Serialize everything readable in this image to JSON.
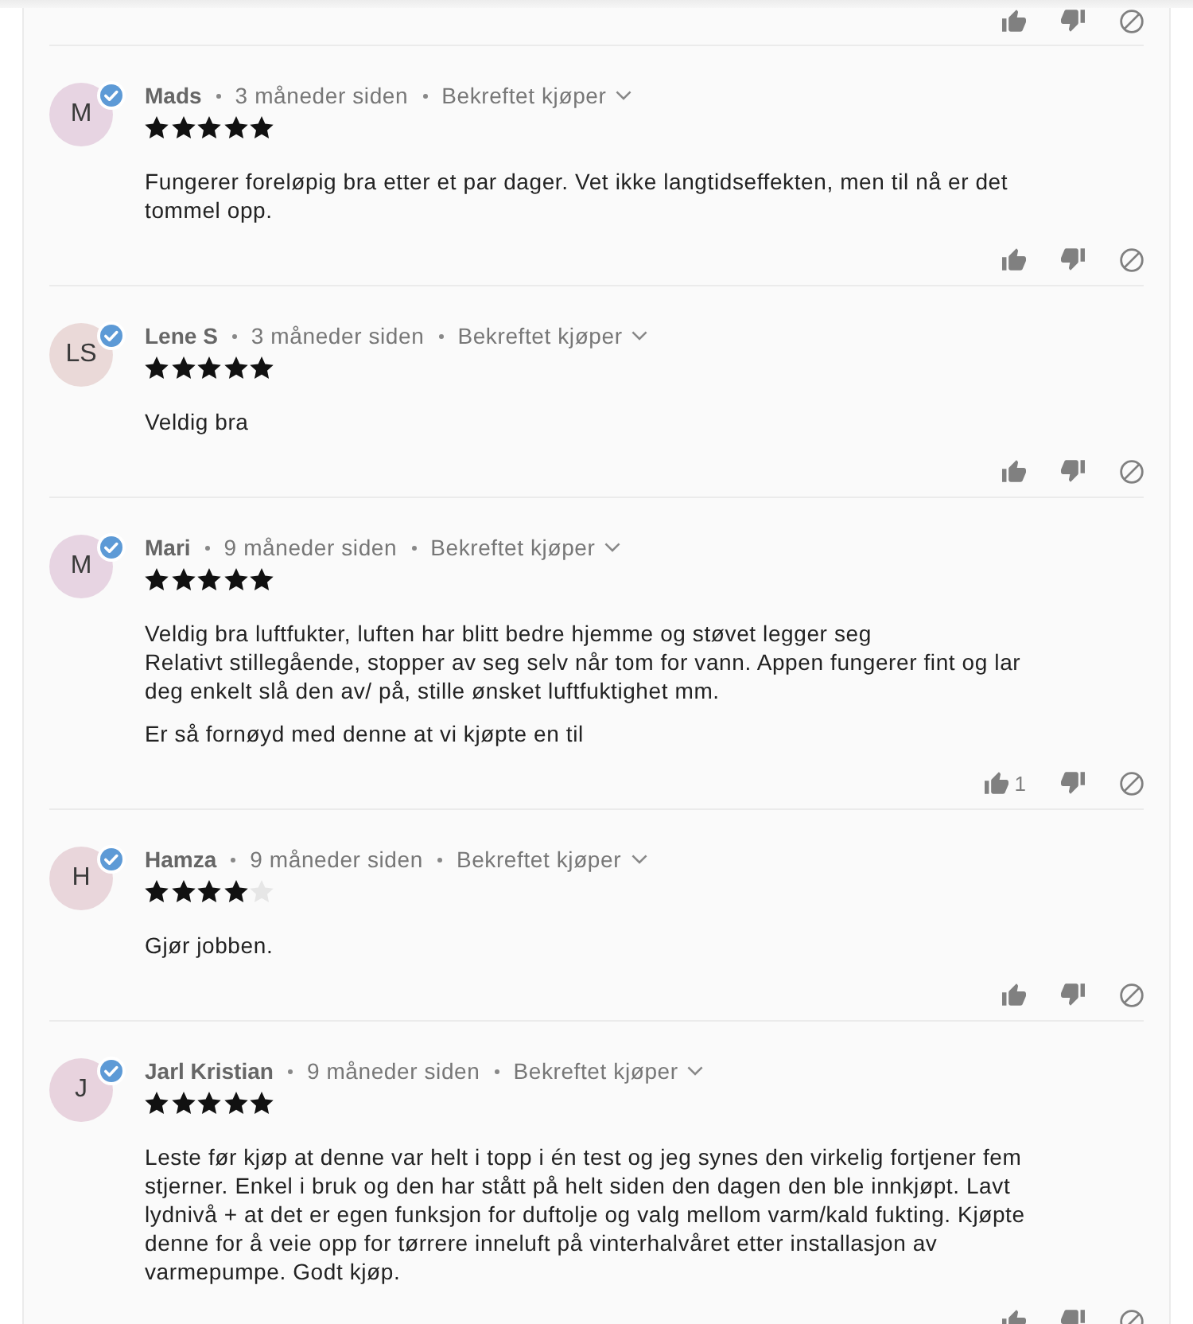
{
  "reviews": [
    {
      "avatar": {
        "initials": "M",
        "color": "#e7d4e2",
        "verified": true
      },
      "name": "Mads",
      "time": "3 måneder siden",
      "badge": "Bekreftet kjøper",
      "stars": 5,
      "paragraphs": [
        "Fungerer foreløpig bra etter et par dager. Vet ikke langtidseffekten, men til nå er det tommel opp."
      ]
    },
    {
      "avatar": {
        "initials": "LS",
        "color": "#ead9d8",
        "verified": true
      },
      "name": "Lene S",
      "time": "3 måneder siden",
      "badge": "Bekreftet kjøper",
      "stars": 5,
      "paragraphs": [
        "Veldig bra"
      ]
    },
    {
      "avatar": {
        "initials": "M",
        "color": "#e7d4e2",
        "verified": true
      },
      "name": "Mari",
      "time": "9 måneder siden",
      "badge": "Bekreftet kjøper",
      "stars": 5,
      "paragraphs": [
        "Veldig bra luftfukter, luften har blitt bedre hjemme og støvet legger seg\nRelativt stillegående, stopper av seg selv når tom for vann. Appen fungerer fint og lar deg enkelt slå den av/ på, stille ønsket luftfuktighet mm.",
        "Er så fornøyd med denne at vi kjøpte en til"
      ],
      "helpful_count": "1"
    },
    {
      "avatar": {
        "initials": "H",
        "color": "#e9d6db",
        "verified": true
      },
      "name": "Hamza",
      "time": "9 måneder siden",
      "badge": "Bekreftet kjøper",
      "stars": 4,
      "paragraphs": [
        "Gjør jobben."
      ]
    },
    {
      "avatar": {
        "initials": "J",
        "color": "#e8d3de",
        "verified": true
      },
      "name": "Jarl Kristian",
      "time": "9 måneder siden",
      "badge": "Bekreftet kjøper",
      "stars": 5,
      "paragraphs": [
        "Leste før kjøp at denne var helt i topp i én test og jeg synes den virkelig fortjener fem stjerner. Enkel i bruk og den har stått på helt siden den dagen den ble innkjøpt. Lavt lydnivå + at det er egen funksjon for duftolje og valg mellom varm/kald fukting. Kjøpte denne for å veie opp for tørrere inneluft på vinterhalvåret etter installasjon av varmepumpe. Godt kjøp."
      ]
    }
  ]
}
